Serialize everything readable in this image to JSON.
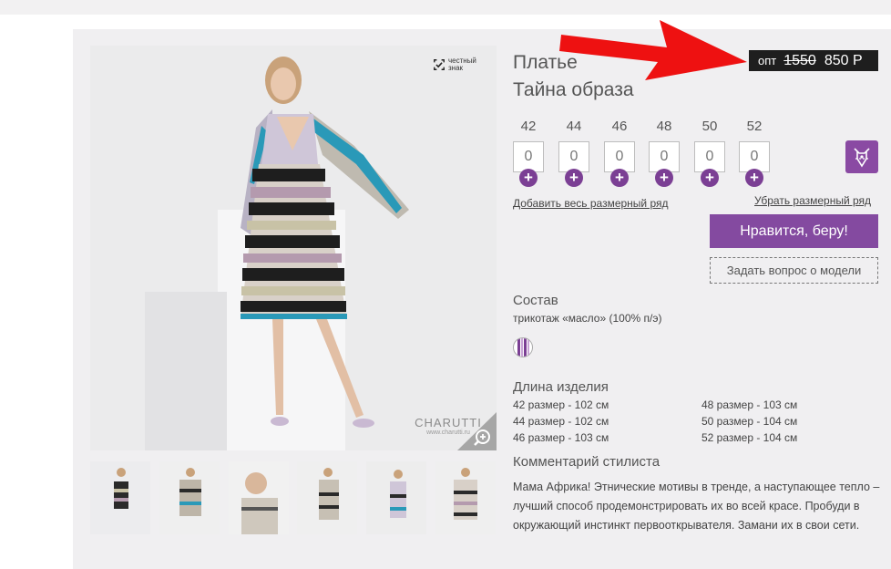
{
  "product": {
    "title_line1": "Платье",
    "title_line2": "Тайна образа",
    "badge_honest": "честный знак",
    "brand_name": "CHARUTTI",
    "brand_url": "www.charutti.ru"
  },
  "price": {
    "label": "опт",
    "old": "1550",
    "new": "850 Р"
  },
  "sizes": [
    {
      "size": "42",
      "qty": "0"
    },
    {
      "size": "44",
      "qty": "0"
    },
    {
      "size": "46",
      "qty": "0"
    },
    {
      "size": "48",
      "qty": "0"
    },
    {
      "size": "50",
      "qty": "0"
    },
    {
      "size": "52",
      "qty": "0"
    }
  ],
  "plus_glyph": "+",
  "links": {
    "add_all": "Добавить весь размерный ряд",
    "remove_all": "Убрать размерный ряд"
  },
  "buttons": {
    "like": "Нравится, беру!",
    "ask": "Задать вопрос о модели"
  },
  "composition": {
    "title": "Состав",
    "value": "трикотаж «масло» (100% п/э)"
  },
  "length": {
    "title": "Длина изделия",
    "left": [
      "42 размер - 102 см",
      "44 размер - 102 см",
      "46 размер - 103 см"
    ],
    "right": [
      "48 размер - 103 см",
      "50 размер - 104 см",
      "52 размер - 104 см"
    ]
  },
  "stylist": {
    "title": "Комментарий стилиста",
    "text": "Мама Африка! Этнические мотивы в тренде, а наступающее тепло – лучший способ продемонстрировать их во всей красе. Пробуди в окружающий инстинкт первооткрывателя. Замани их в свои сети."
  },
  "colors": {
    "accent": "#844aa0",
    "price_bg": "#1e1e1e",
    "arrow": "#ee1111"
  },
  "icons": [
    "zoom-icon",
    "honest-sign-icon",
    "body-measure-icon",
    "red-arrow"
  ]
}
